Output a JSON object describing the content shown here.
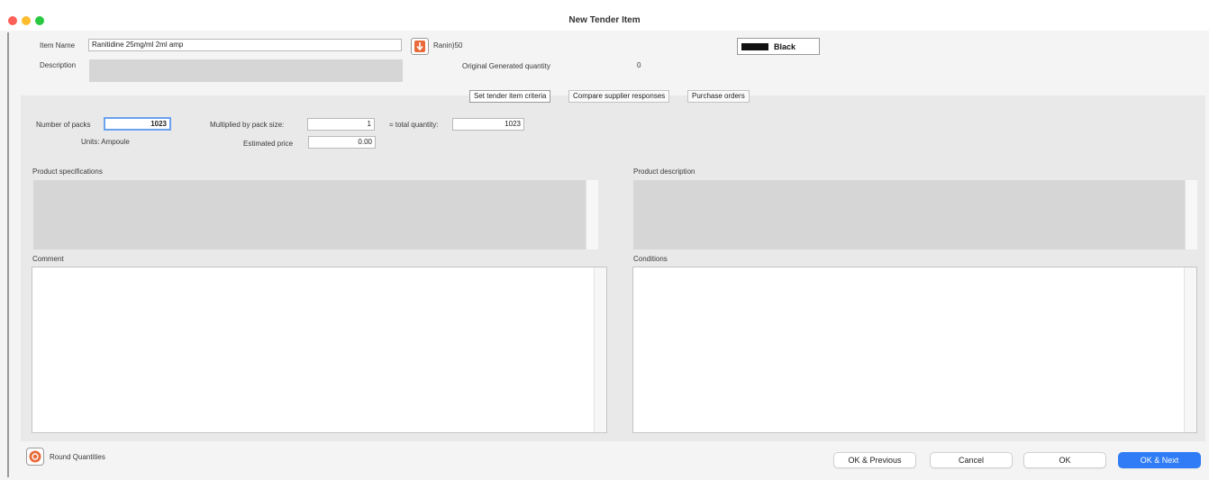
{
  "window": {
    "title": "New Tender Item",
    "traffic_lights": {
      "close": "#fe5f57",
      "minimize": "#febc2e",
      "zoom": "#28c840"
    }
  },
  "header": {
    "item_name_label": "Item Name",
    "item_name_value": "Ranitidine 25mg/ml 2ml amp",
    "item_code": "Ranin)50",
    "item_lookup_icon": "down-arrow-icon",
    "description_label": "Description",
    "original_qty_label": "Original Generated quantity",
    "original_qty_value": "0",
    "color_label": "Black",
    "color_value": "#111111"
  },
  "tabs": [
    {
      "label": "Set tender item criteria",
      "active": true
    },
    {
      "label": "Compare supplier responses",
      "active": false
    },
    {
      "label": "Purchase orders",
      "active": false
    }
  ],
  "criteria": {
    "packs_label": "Number of packs",
    "packs_value": "1023",
    "units_label": "Units: Ampoule",
    "pack_size_label": "Multiplied by pack size:",
    "pack_size_value": "1",
    "total_label": "= total quantity:",
    "total_value": "1023",
    "price_label": "Estimated price",
    "price_value": "0.00",
    "product_spec_label": "Product specifications",
    "product_desc_label": "Product description",
    "comment_label": "Comment",
    "conditions_label": "Conditions"
  },
  "footer": {
    "round_label": "Round Quantities",
    "round_icon": "round-quantities-icon",
    "ok_previous": "OK & Previous",
    "cancel": "Cancel",
    "ok": "OK",
    "ok_next": "OK & Next",
    "accent": "#2f7cf6"
  }
}
